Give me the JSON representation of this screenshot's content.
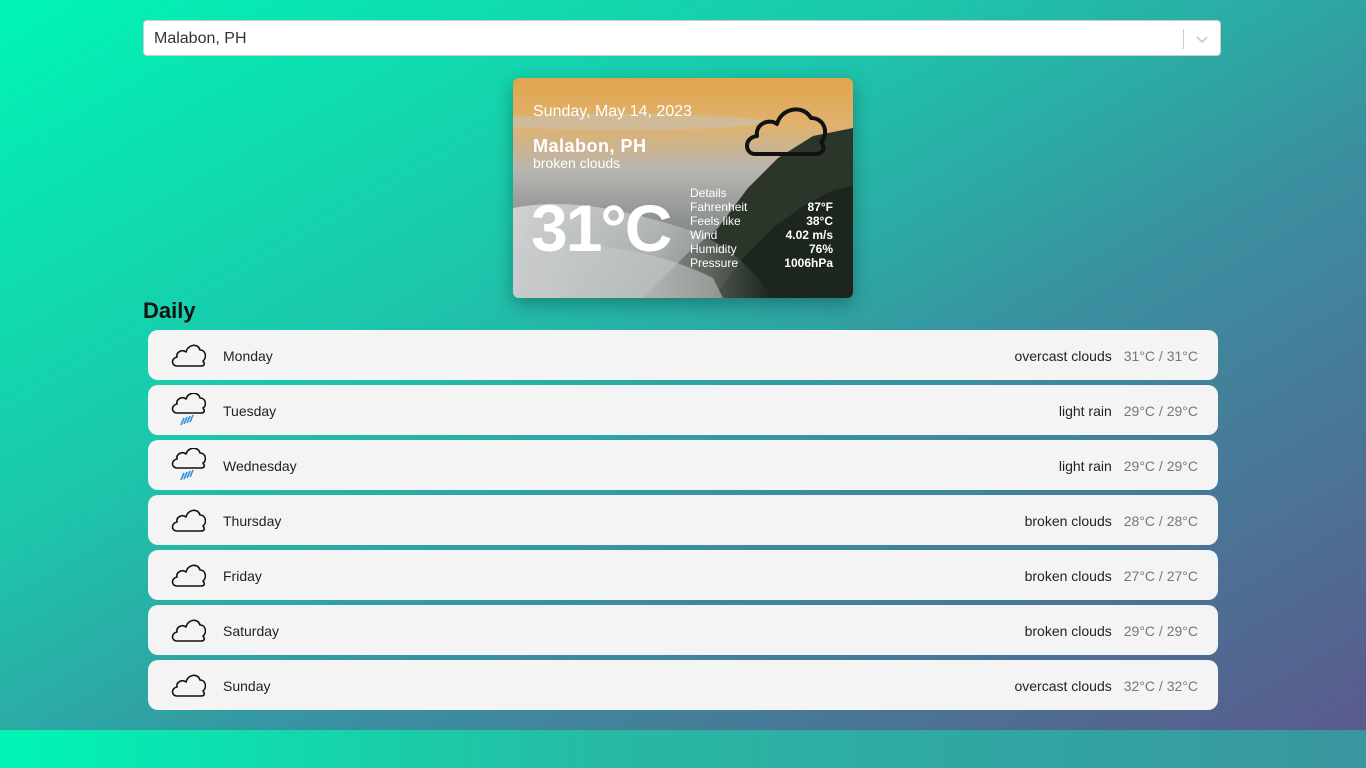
{
  "search": {
    "value": "Malabon, PH"
  },
  "current": {
    "date": "Sunday, May 14, 2023",
    "city": "Malabon, PH",
    "description": "broken clouds",
    "temperature": "31°C",
    "icon": "cloud-icon",
    "details": {
      "title": "Details",
      "rows": [
        {
          "label": "Fahrenheit",
          "value": "87°F"
        },
        {
          "label": "Feels like",
          "value": "38°C"
        },
        {
          "label": "Wind",
          "value": "4.02 m/s"
        },
        {
          "label": "Humidity",
          "value": "76%"
        },
        {
          "label": "Pressure",
          "value": "1006hPa"
        }
      ]
    }
  },
  "daily": {
    "title": "Daily",
    "days": [
      {
        "day": "Monday",
        "description": "overcast clouds",
        "range": "31°C / 31°C",
        "icon": "cloud-icon"
      },
      {
        "day": "Tuesday",
        "description": "light rain",
        "range": "29°C / 29°C",
        "icon": "rain-icon"
      },
      {
        "day": "Wednesday",
        "description": "light rain",
        "range": "29°C / 29°C",
        "icon": "rain-icon"
      },
      {
        "day": "Thursday",
        "description": "broken clouds",
        "range": "28°C / 28°C",
        "icon": "cloud-icon"
      },
      {
        "day": "Friday",
        "description": "broken clouds",
        "range": "27°C / 27°C",
        "icon": "cloud-icon"
      },
      {
        "day": "Saturday",
        "description": "broken clouds",
        "range": "29°C / 29°C",
        "icon": "cloud-icon"
      },
      {
        "day": "Sunday",
        "description": "overcast clouds",
        "range": "32°C / 32°C",
        "icon": "cloud-icon"
      }
    ]
  }
}
